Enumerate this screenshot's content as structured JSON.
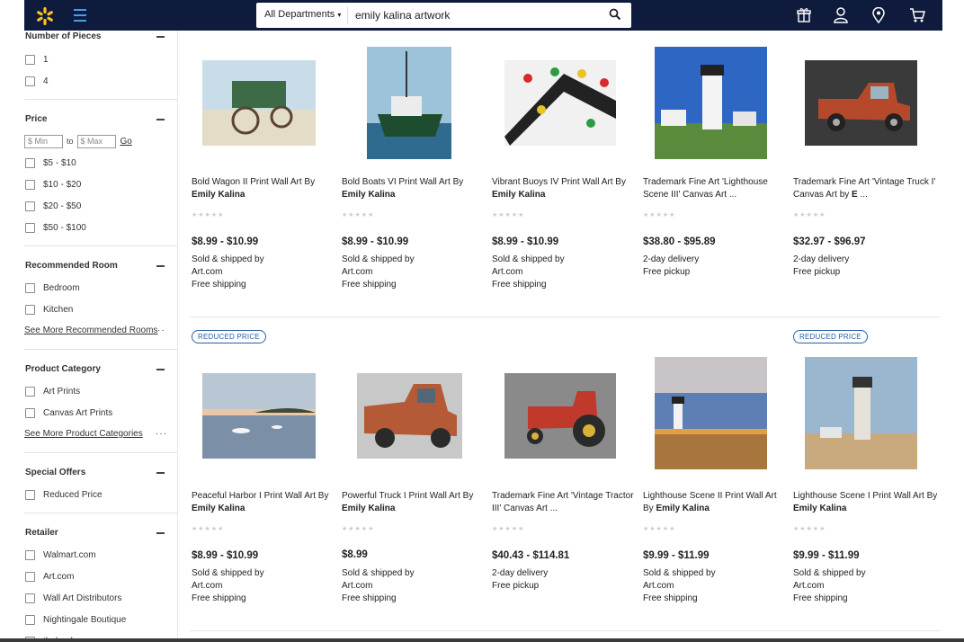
{
  "header": {
    "department": "All Departments",
    "search_value": "emily kalina artwork",
    "colors": {
      "nav_bg": "#0f1b3d",
      "spark": "#ffc220",
      "accent": "#4a9ce8"
    },
    "icons": [
      "spark-logo-icon",
      "menu-icon",
      "search-icon",
      "gift-registry-icon",
      "account-icon",
      "location-icon",
      "cart-icon"
    ]
  },
  "sidebar": {
    "pieces": {
      "title": "Number of Pieces",
      "options": [
        "1",
        "4"
      ]
    },
    "price": {
      "title": "Price",
      "min_placeholder": "$ Min",
      "to": "to",
      "max_placeholder": "$ Max",
      "go": "Go",
      "options": [
        "$5 - $10",
        "$10 - $20",
        "$20 - $50",
        "$50 - $100"
      ]
    },
    "room": {
      "title": "Recommended Room",
      "options": [
        "Bedroom",
        "Kitchen"
      ],
      "see_more": "See More Recommended Rooms"
    },
    "category": {
      "title": "Product Category",
      "options": [
        "Art Prints",
        "Canvas Art Prints"
      ],
      "see_more": "See More Product Categories"
    },
    "offers": {
      "title": "Special Offers",
      "options": [
        "Reduced Price"
      ]
    },
    "retailer": {
      "title": "Retailer",
      "options": [
        "Walmart.com",
        "Art.com",
        "Wall Art Distributors",
        "Nightingale Boutique",
        "thebookpros"
      ]
    }
  },
  "products": [
    {
      "title": "Bold Wagon II Print Wall Art By ",
      "author": "Emily Kalina",
      "price": "$8.99 - $10.99",
      "ship": [
        "Sold & shipped by",
        "Art.com",
        "Free shipping"
      ]
    },
    {
      "title": "Bold Boats VI Print Wall Art By ",
      "author": "Emily Kalina",
      "price": "$8.99 - $10.99",
      "ship": [
        "Sold & shipped by",
        "Art.com",
        "Free shipping"
      ]
    },
    {
      "title": "Vibrant Buoys IV Print Wall Art By ",
      "author": "Emily Kalina",
      "price": "$8.99 - $10.99",
      "ship": [
        "Sold & shipped by",
        "Art.com",
        "Free shipping"
      ]
    },
    {
      "title": "Trademark Fine Art 'Lighthouse Scene III' Canvas Art ...",
      "author": "",
      "price": "$38.80 - $95.89",
      "ship": [
        "2-day delivery",
        "Free pickup",
        ""
      ]
    },
    {
      "title": "Trademark Fine Art 'Vintage Truck I' Canvas Art by ",
      "author": "E",
      "title_tail": " ...",
      "price": "$32.97 - $96.97",
      "ship": [
        "2-day delivery",
        "Free pickup",
        ""
      ]
    },
    {
      "badge": "REDUCED PRICE",
      "title": "Peaceful Harbor I Print Wall Art By ",
      "author": "Emily Kalina",
      "price": "$8.99 - $10.99",
      "ship": [
        "Sold & shipped by",
        "Art.com",
        "Free shipping"
      ]
    },
    {
      "title": "Powerful Truck I Print Wall Art By ",
      "author": "Emily Kalina",
      "price": "$8.99",
      "ship": [
        "Sold & shipped by",
        "Art.com",
        "Free shipping"
      ]
    },
    {
      "title": "Trademark Fine Art 'Vintage Tractor III' Canvas Art ...",
      "author": "",
      "price": "$40.43 - $114.81",
      "ship": [
        "2-day delivery",
        "Free pickup",
        ""
      ]
    },
    {
      "title": "Lighthouse Scene II Print Wall Art By ",
      "author": "Emily Kalina",
      "price": "$9.99 - $11.99",
      "ship": [
        "Sold & shipped by",
        "Art.com",
        "Free shipping"
      ]
    },
    {
      "badge": "REDUCED PRICE",
      "title": "Lighthouse Scene I Print Wall Art By ",
      "author": "Emily Kalina",
      "price": "$9.99 - $11.99",
      "ship": [
        "Sold & shipped by",
        "Art.com",
        "Free shipping"
      ]
    }
  ]
}
